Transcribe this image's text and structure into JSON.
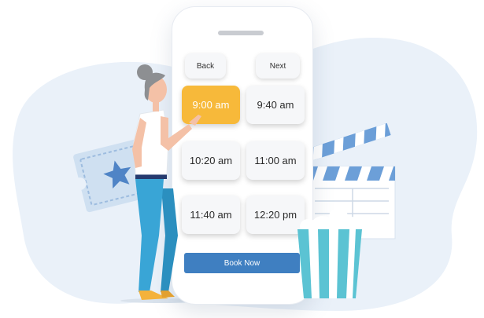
{
  "booking": {
    "back_label": "Back",
    "next_label": "Next",
    "time_slots": [
      "9:00 am",
      "9:40 am",
      "10:20 am",
      "11:00 am",
      "11:40 am",
      "12:20 pm"
    ],
    "selected_slot": "9:00 am",
    "book_label": "Book Now"
  },
  "colors": {
    "accent_selected": "#f7b93a",
    "book_button": "#3f7fc1",
    "background_blob": "#eaf1f9"
  }
}
